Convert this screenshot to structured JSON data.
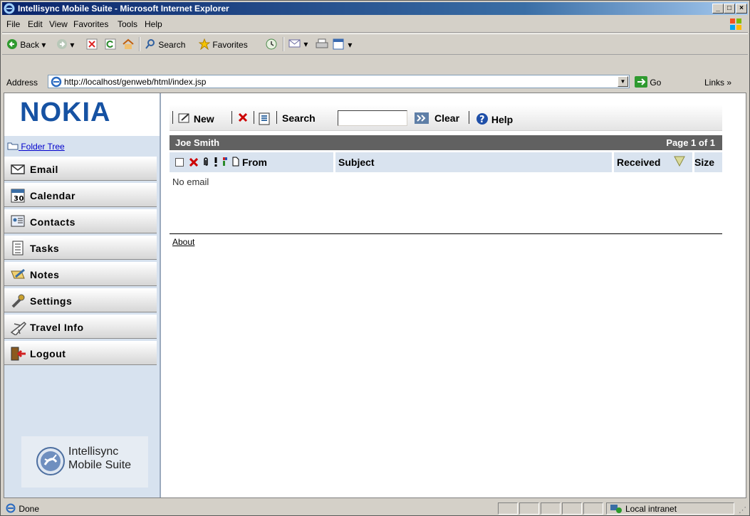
{
  "window": {
    "title": "Intellisync Mobile Suite - Microsoft Internet Explorer",
    "minimize": "_",
    "maximize": "□",
    "close": "×"
  },
  "menu": [
    "File",
    "Edit",
    "View",
    "Favorites",
    "Tools",
    "Help"
  ],
  "toolbar": {
    "back": "Back",
    "search": "Search",
    "favorites": "Favorites"
  },
  "address": {
    "label": "Address",
    "url": "http://localhost/genweb/html/index.jsp",
    "go": "Go",
    "links": "Links"
  },
  "sidebar": {
    "brand": "NOKIA",
    "folder_tree": "Folder Tree",
    "items": [
      {
        "label": "Email",
        "icon": "envelope-icon"
      },
      {
        "label": "Calendar",
        "icon": "calendar-icon"
      },
      {
        "label": "Contacts",
        "icon": "address-book-icon"
      },
      {
        "label": "Tasks",
        "icon": "task-list-icon"
      },
      {
        "label": "Notes",
        "icon": "notes-icon"
      },
      {
        "label": "Settings",
        "icon": "wrench-icon"
      },
      {
        "label": "Travel Info",
        "icon": "airplane-icon"
      },
      {
        "label": "Logout",
        "icon": "door-exit-icon"
      }
    ],
    "product_line1": "Intellisync",
    "product_line2": "Mobile Suite"
  },
  "actions": {
    "new": "New",
    "search": "Search",
    "search_value": "",
    "clear": "Clear",
    "help": "Help"
  },
  "mailbox": {
    "user": "Joe Smith",
    "page": "Page 1 of 1",
    "columns": {
      "from": "From",
      "subject": "Subject",
      "received": "Received",
      "size": "Size"
    },
    "empty_message": "No email",
    "about": "About"
  },
  "status": {
    "text": "Done",
    "zone": "Local intranet"
  }
}
